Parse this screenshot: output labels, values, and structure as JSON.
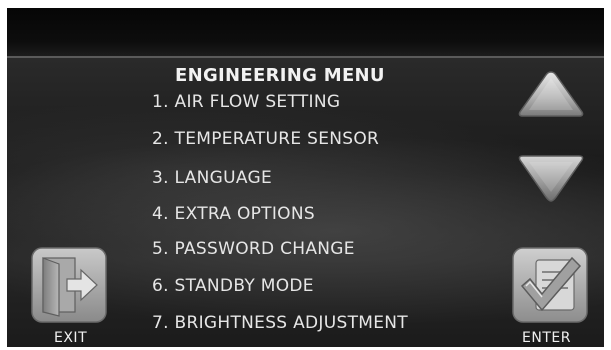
{
  "header": {
    "title": "ENGINEERING MENU"
  },
  "menu": {
    "items": [
      {
        "label": "1. AIR FLOW SETTING"
      },
      {
        "label": "2. TEMPERATURE SENSOR"
      },
      {
        "label": "3. LANGUAGE"
      },
      {
        "label": "4. EXTRA OPTIONS"
      },
      {
        "label": "5. PASSWORD CHANGE"
      },
      {
        "label": "6. STANDBY MODE"
      },
      {
        "label": "7. BRIGHTNESS ADJUSTMENT"
      }
    ]
  },
  "controls": {
    "up_icon": "triangle-up-icon",
    "down_icon": "triangle-down-icon",
    "exit_label": "EXIT",
    "exit_icon": "door-exit-icon",
    "enter_label": "ENTER",
    "enter_icon": "checkmark-clipboard-icon"
  },
  "colors": {
    "screen_bg": "#111111",
    "text": "#e6e6e6",
    "button_gray": "#9c9c9c"
  }
}
